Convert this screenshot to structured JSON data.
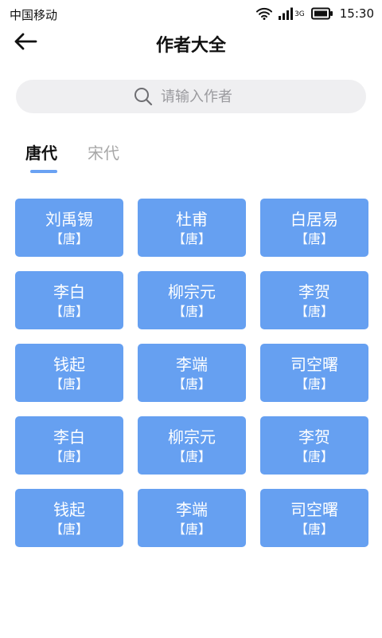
{
  "status_bar": {
    "carrier": "中国移动",
    "network_type": "3G",
    "time": "15:30",
    "icons": [
      "wifi-icon",
      "signal-icon",
      "battery-icon"
    ]
  },
  "header": {
    "back_icon": "arrow-left-icon",
    "title": "作者大全"
  },
  "search": {
    "icon": "search-icon",
    "placeholder": "请输入作者"
  },
  "tabs": [
    {
      "label": "唐代",
      "active": true
    },
    {
      "label": "宋代",
      "active": false
    }
  ],
  "authors": [
    {
      "name": "刘禹锡",
      "dynasty": "【唐】"
    },
    {
      "name": "杜甫",
      "dynasty": "【唐】"
    },
    {
      "name": "白居易",
      "dynasty": "【唐】"
    },
    {
      "name": "李白",
      "dynasty": "【唐】"
    },
    {
      "name": "柳宗元",
      "dynasty": "【唐】"
    },
    {
      "name": "李贺",
      "dynasty": "【唐】"
    },
    {
      "name": "钱起",
      "dynasty": "【唐】"
    },
    {
      "name": "李端",
      "dynasty": "【唐】"
    },
    {
      "name": "司空曙",
      "dynasty": "【唐】"
    },
    {
      "name": "李白",
      "dynasty": "【唐】"
    },
    {
      "name": "柳宗元",
      "dynasty": "【唐】"
    },
    {
      "name": "李贺",
      "dynasty": "【唐】"
    },
    {
      "name": "钱起",
      "dynasty": "【唐】"
    },
    {
      "name": "李端",
      "dynasty": "【唐】"
    },
    {
      "name": "司空曙",
      "dynasty": "【唐】"
    }
  ],
  "colors": {
    "card_background": "#66a0f1",
    "tab_indicator": "#6aa2f3",
    "search_background": "#efeff1",
    "inactive_tab_text": "#a8a8a8"
  }
}
